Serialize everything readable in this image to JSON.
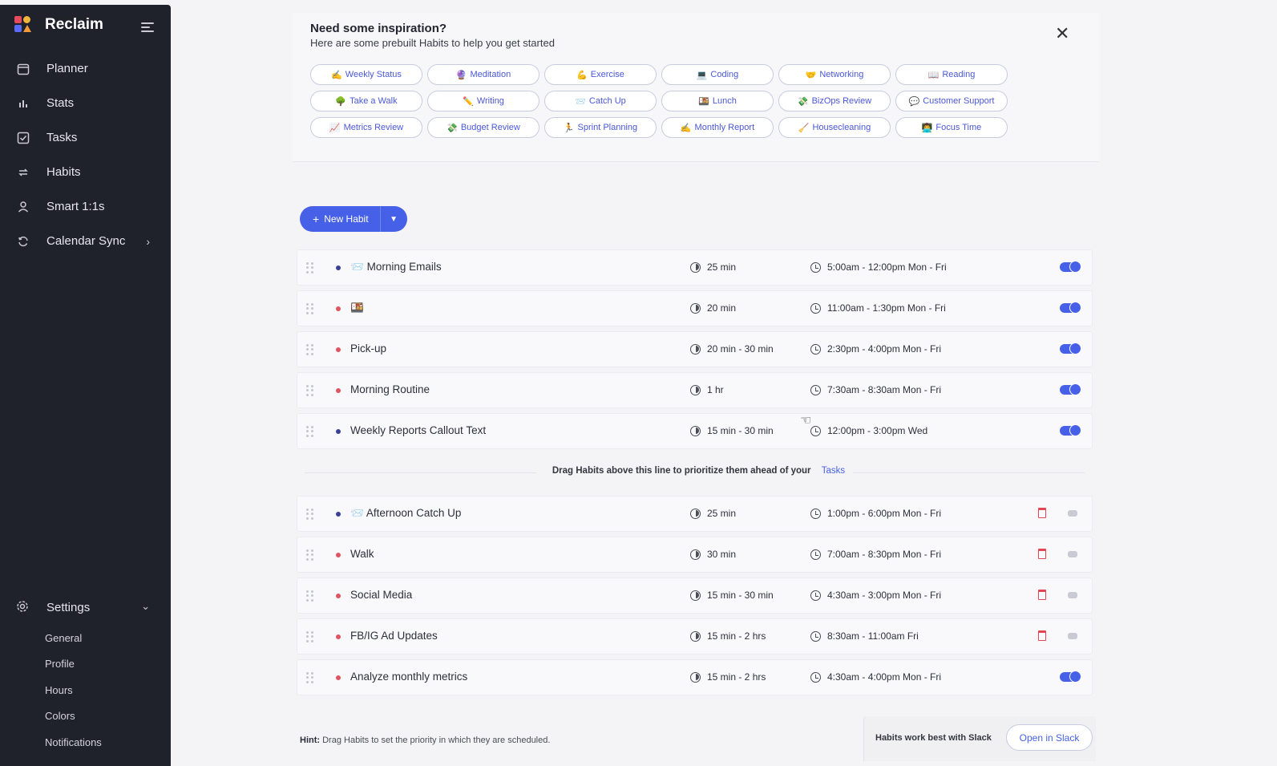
{
  "app": {
    "name": "Reclaim"
  },
  "sidebar": {
    "items": [
      {
        "label": "Planner",
        "icon": "calendar-icon"
      },
      {
        "label": "Stats",
        "icon": "bar-chart-icon"
      },
      {
        "label": "Tasks",
        "icon": "checkbox-icon"
      },
      {
        "label": "Habits",
        "icon": "repeat-icon"
      },
      {
        "label": "Smart 1:1s",
        "icon": "people-icon"
      },
      {
        "label": "Calendar Sync",
        "icon": "sync-icon"
      }
    ],
    "settings": {
      "label": "Settings",
      "items": [
        "General",
        "Profile",
        "Hours",
        "Colors",
        "Notifications"
      ]
    }
  },
  "inspiration": {
    "title": "Need some inspiration?",
    "subtitle": "Here are some prebuilt Habits to help you get started",
    "chips": [
      {
        "emoji": "✍️",
        "label": "Weekly Status"
      },
      {
        "emoji": "🔮",
        "label": "Meditation"
      },
      {
        "emoji": "💪",
        "label": "Exercise"
      },
      {
        "emoji": "💻",
        "label": "Coding"
      },
      {
        "emoji": "🤝",
        "label": "Networking"
      },
      {
        "emoji": "📖",
        "label": "Reading"
      },
      {
        "emoji": "🌳",
        "label": "Take a Walk"
      },
      {
        "emoji": "✏️",
        "label": "Writing"
      },
      {
        "emoji": "📨",
        "label": "Catch Up"
      },
      {
        "emoji": "🍱",
        "label": "Lunch"
      },
      {
        "emoji": "💸",
        "label": "BizOps Review"
      },
      {
        "emoji": "💬",
        "label": "Customer Support"
      },
      {
        "emoji": "📈",
        "label": "Metrics Review"
      },
      {
        "emoji": "💸",
        "label": "Budget Review"
      },
      {
        "emoji": "🏃",
        "label": "Sprint Planning"
      },
      {
        "emoji": "✍️",
        "label": "Monthly Report"
      },
      {
        "emoji": "🧹",
        "label": "Housecleaning"
      },
      {
        "emoji": "👨‍💻",
        "label": "Focus Time"
      }
    ]
  },
  "new_habit": {
    "label": "New Habit",
    "plus": "+"
  },
  "habits_prioritized": [
    {
      "emoji": "📨",
      "name": "Morning Emails",
      "dot": "#3a3f9a",
      "duration": "25 min",
      "time": "5:00am - 12:00pm Mon - Fri",
      "enabled": true
    },
    {
      "emoji": "🍱",
      "name": "",
      "dot": "#e0545f",
      "duration": "20 min",
      "time": "11:00am - 1:30pm Mon - Fri",
      "enabled": true
    },
    {
      "emoji": "",
      "name": "Pick-up",
      "dot": "#e0545f",
      "duration": "20 min - 30 min",
      "time": "2:30pm - 4:00pm Mon - Fri",
      "enabled": true
    },
    {
      "emoji": "",
      "name": "Morning Routine",
      "dot": "#e0545f",
      "duration": "1 hr",
      "time": "7:30am - 8:30am Mon - Fri",
      "enabled": true
    },
    {
      "emoji": "",
      "name": "Weekly Reports Callout Text",
      "dot": "#3a3f9a",
      "duration": "15 min - 30 min",
      "time": "12:00pm - 3:00pm Wed",
      "enabled": true
    }
  ],
  "divider": {
    "text": "Drag Habits above this line to prioritize them ahead of your",
    "link": "Tasks"
  },
  "habits_other": [
    {
      "emoji": "📨",
      "name": "Afternoon Catch Up",
      "dot": "#3a3f9a",
      "duration": "25 min",
      "time": "1:00pm - 6:00pm Mon - Fri",
      "enabled": false,
      "trash": true
    },
    {
      "emoji": "",
      "name": "Walk",
      "dot": "#e0545f",
      "duration": "30 min",
      "time": "7:00am - 8:30pm Mon - Fri",
      "enabled": false,
      "trash": true
    },
    {
      "emoji": "",
      "name": "Social Media",
      "dot": "#e0545f",
      "duration": "15 min - 30 min",
      "time": "4:30am - 3:00pm Mon - Fri",
      "enabled": false,
      "trash": true
    },
    {
      "emoji": "",
      "name": "FB/IG Ad Updates",
      "dot": "#e0545f",
      "duration": "15 min - 2 hrs",
      "time": "8:30am - 11:00am Fri",
      "enabled": false,
      "trash": true
    },
    {
      "emoji": "",
      "name": "Analyze monthly metrics",
      "dot": "#e0545f",
      "duration": "15 min - 2 hrs",
      "time": "4:30am - 4:00pm Mon - Fri",
      "enabled": true,
      "trash": false
    }
  ],
  "footer": {
    "hint_bold": "Hint:",
    "hint_text": "Drag Habits to set the priority in which they are scheduled.",
    "slack_text": "Habits work best with Slack",
    "slack_button": "Open in Slack"
  },
  "colors": {
    "accent": "#4660e8",
    "sidebar": "#1f212b",
    "danger": "#e34552"
  }
}
